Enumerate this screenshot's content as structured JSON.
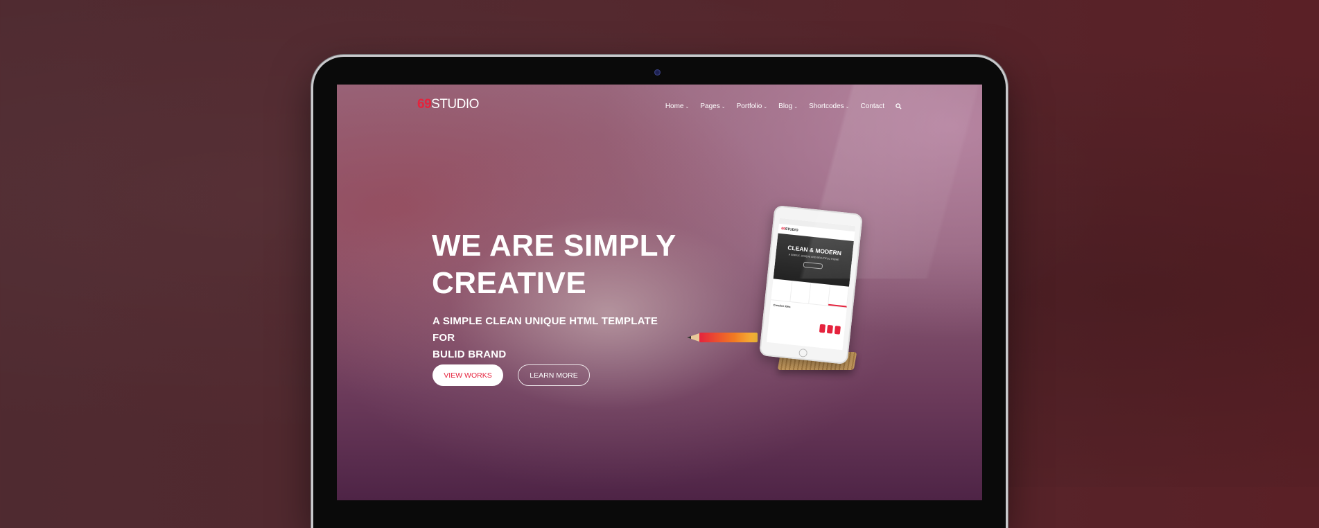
{
  "logo": {
    "number": "69",
    "text": "STUDIO"
  },
  "nav": {
    "items": [
      {
        "label": "Home",
        "dropdown": true
      },
      {
        "label": "Pages",
        "dropdown": true
      },
      {
        "label": "Portfolio",
        "dropdown": true
      },
      {
        "label": "Blog",
        "dropdown": true
      },
      {
        "label": "Shortcodes",
        "dropdown": true
      },
      {
        "label": "Contact",
        "dropdown": false
      }
    ],
    "search_icon": "search-icon"
  },
  "hero": {
    "title_line1": "WE ARE SIMPLY",
    "title_line2": "CREATIVE",
    "subtitle_line1": "A SIMPLE CLEAN UNIQUE HTML TEMPLATE FOR",
    "subtitle_line2": "BULID BRAND",
    "btn_works": "VIEW WORKS",
    "btn_more": "LEARN MORE"
  },
  "tablet": {
    "logo_number": "69",
    "logo_text": "STUDIO",
    "hero_title": "CLEAN & MODERN",
    "hero_sub": "A SIMPLE, UNIQUE AND BEAUTIFUL THEME",
    "section_title": "Creative Idea"
  },
  "colors": {
    "accent": "#e5233d",
    "background": "#53282e"
  }
}
